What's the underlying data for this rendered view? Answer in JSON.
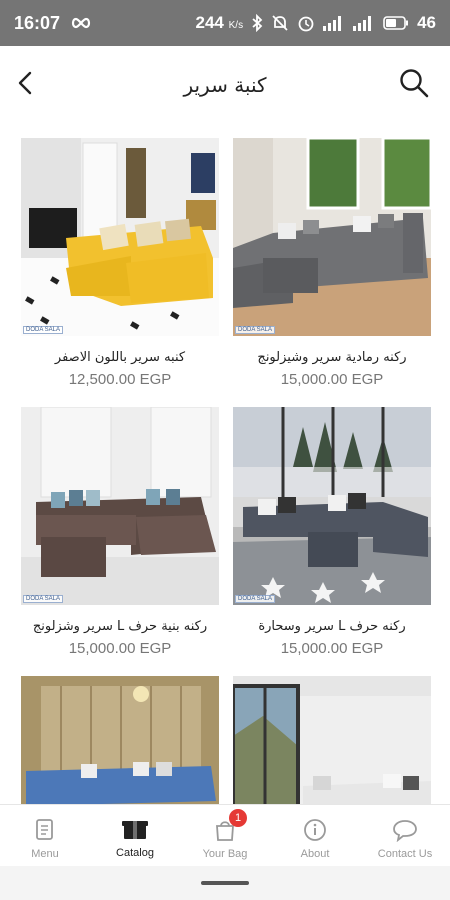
{
  "status_bar": {
    "time": "16:07",
    "net_speed": "244",
    "net_unit": "K/s",
    "battery": "46",
    "icons": [
      "infinity-icon",
      "bluetooth-icon",
      "mute-icon",
      "alarm-icon",
      "signal-icon",
      "wifi-icon",
      "battery-icon"
    ]
  },
  "header": {
    "title": "كنبة سرير",
    "back_icon": "back-arrow-icon",
    "search_icon": "search-icon"
  },
  "brand_tag": "DODA SALA",
  "products": [
    {
      "name": "كنبه سرير باللون الاصفر",
      "price": "12,500.00 EGP",
      "image": "yellow-sofa-bed"
    },
    {
      "name": "ركنه رمادية سرير وشيزلونج",
      "price": "15,000.00 EGP",
      "image": "grey-corner-sofa"
    },
    {
      "name": "ركنه بنية حرف L سرير وشزلونج",
      "price": "15,000.00 EGP",
      "image": "brown-l-sofa"
    },
    {
      "name": "ركنه حرف L سرير وسحارة",
      "price": "15,000.00 EGP",
      "image": "grey-l-sofa-storage"
    },
    {
      "name": "",
      "price": "",
      "image": "blue-corner-sofa"
    },
    {
      "name": "",
      "price": "",
      "image": "white-sofa-window"
    }
  ],
  "bottom_nav": {
    "items": [
      {
        "label": "Menu",
        "icon": "menu-book-icon",
        "active": false
      },
      {
        "label": "Catalog",
        "icon": "catalog-box-icon",
        "active": true
      },
      {
        "label": "Your Bag",
        "icon": "shopping-bag-icon",
        "active": false,
        "badge": "1"
      },
      {
        "label": "About",
        "icon": "info-icon",
        "active": false
      },
      {
        "label": "Contact Us",
        "icon": "chat-bubble-icon",
        "active": false
      }
    ]
  },
  "colors": {
    "status_bar": "#757575",
    "badge": "#e53935",
    "price": "#777777",
    "nav_inactive": "#9a9a9a"
  }
}
